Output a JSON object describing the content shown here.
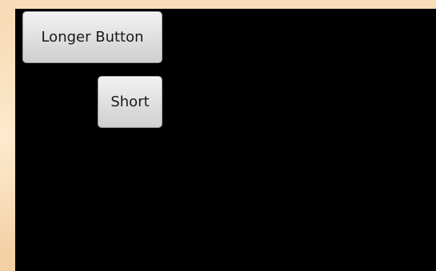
{
  "buttons": {
    "longer_label": "Longer Button",
    "short_label": "Short"
  },
  "colors": {
    "screen_background": "#000000",
    "outer_frame": "#f6d6ad",
    "button_face": "#e2e2e2",
    "button_text": "#1a1a1a"
  }
}
